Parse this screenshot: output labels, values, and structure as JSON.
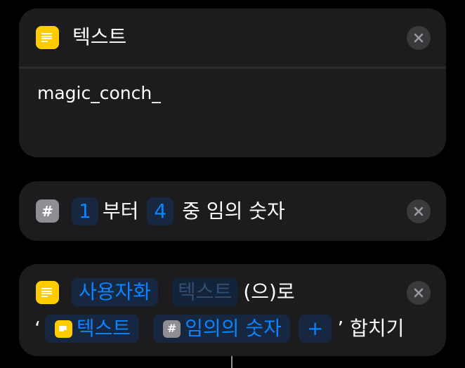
{
  "text_action": {
    "title": "텍스트",
    "content": "magic_conch_",
    "icon": "text-lines-icon"
  },
  "random_action": {
    "icon_glyph": "#",
    "min": "1",
    "from_label": "부터",
    "max": "4",
    "rest_label": "중 임의 숫자"
  },
  "combine_action": {
    "token_user": "사용자화",
    "token_text_dim": "텍스트",
    "suffix": "(으)로",
    "quote_open": "‘",
    "var_text": "텍스트",
    "var_number_glyph": "#",
    "var_number": "임의의 숫자",
    "plus": "+",
    "quote_close_label": "’ 합치기"
  },
  "colors": {
    "accent": "#0a84ff",
    "card": "#1c1c1e",
    "text_icon": "#ffcc00",
    "number_icon": "#8e8e93"
  }
}
